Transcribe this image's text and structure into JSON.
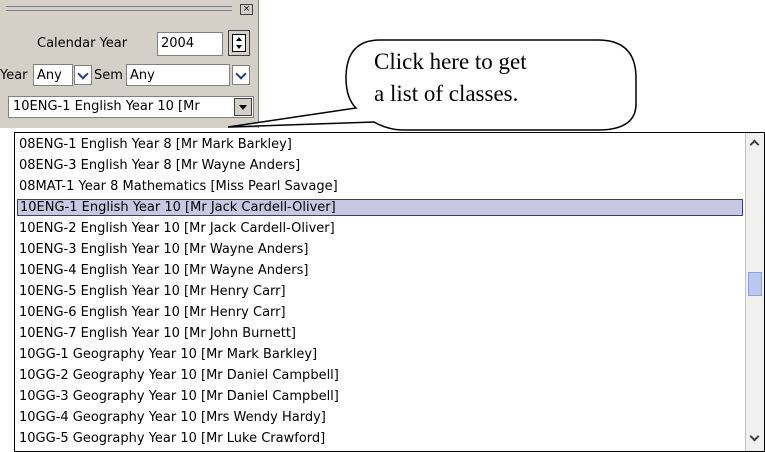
{
  "panel": {
    "calendar_year_label": "Calendar Year",
    "calendar_year_value": "2004",
    "year_label": "Year",
    "year_value": "Any",
    "sem_label": "Sem",
    "sem_value": "Any",
    "class_value": "10ENG-1 English Year 10 [Mr"
  },
  "callout": {
    "line1": "Click here to get",
    "line2": "a list of classes."
  },
  "class_list": {
    "items": [
      "08ENG-1 English Year 8 [Mr Mark Barkley]",
      "08ENG-3 English Year 8 [Mr Wayne Anders]",
      "08MAT-1 Year 8 Mathematics [Miss Pearl Savage]",
      "10ENG-1 English Year 10 [Mr Jack Cardell-Oliver]",
      "10ENG-2 English Year 10 [Mr Jack Cardell-Oliver]",
      "10ENG-3 English Year 10 [Mr Wayne Anders]",
      "10ENG-4 English Year 10 [Mr Wayne Anders]",
      "10ENG-5 English Year 10 [Mr Henry Carr]",
      "10ENG-6 English Year 10 [Mr Henry Carr]",
      "10ENG-7 English Year 10 [Mr John Burnett]",
      "10GG-1 Geography Year 10 [Mr Mark Barkley]",
      "10GG-2 Geography Year 10 [Mr Daniel Campbell]",
      "10GG-3 Geography Year 10 [Mr Daniel Campbell]",
      "10GG-4 Geography Year 10 [Mrs Wendy Hardy]",
      "10GG-5 Geography Year 10 [Mr Luke Crawford]"
    ],
    "selected_index": 3,
    "scroll_position": 0.47
  },
  "colors": {
    "panel_bg": "#d4d0c8",
    "selection_bg": "#c8c8e4",
    "scroll_thumb": "#b8c8ee"
  }
}
